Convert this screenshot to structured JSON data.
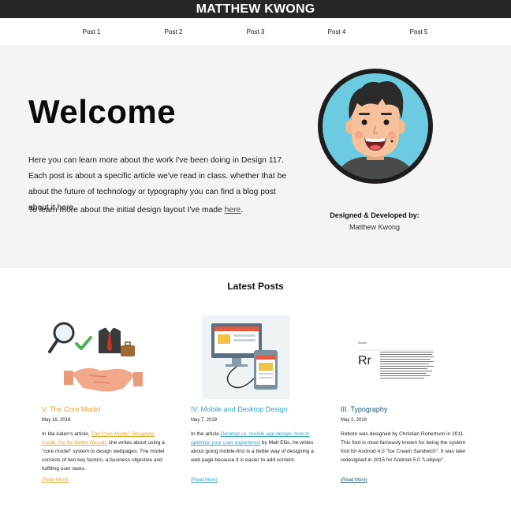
{
  "header": {
    "title": "MATTHEW KWONG"
  },
  "nav": {
    "items": [
      "Post 1",
      "Post 2",
      "Post 3",
      "Post 4",
      "Post 5"
    ]
  },
  "hero": {
    "heading": "Welcome",
    "paragraph1": "Here you can learn more about the work I've been doing in Design 117. Each post is about a specific article we've read in class. whether that be about the future of technology or typography you can find a blog post about it here.",
    "paragraph2_prefix": "To learn more about the initial design layout I've made ",
    "paragraph2_link": "here",
    "paragraph2_suffix": ".",
    "credit_title": "Designed & Developed by:",
    "credit_name": "Matthew Kwong"
  },
  "latest": {
    "heading": "Latest Posts",
    "posts": [
      {
        "title": "V. The Core Model",
        "date": "May 16, 2019",
        "text_before": "In Ida Aalen's article, ",
        "link": "The Core Model: Designing Inside Out for Better Results",
        "text_after": " she writes about using a \"core model\" system to design webpages. The model consists of two key factors, a business objective and fulfilling user tasks.",
        "read_more": "(Read More)",
        "color": "#e3a52b"
      },
      {
        "title": "IV. Mobile and Desktop Design",
        "date": "May 7, 2019",
        "text_before": "In the article ",
        "link": "Desktop vs. mobile app design: how to optimize your user experience",
        "text_after": " by Matt Ellis, he writes about going mobile-first is a better way of designing a web page because it is easier to add content.",
        "read_more": "(Read More)",
        "color": "#3aa0c8"
      },
      {
        "title": "III. Typography",
        "date": "May 2, 2019",
        "text_before": "Roboto was designed by Christian Robertson in 2011. This font is most famously known for being the system font for Android 4.0 \"Ice Cream Sandwich\". It was later redesigned in 2015 for Android 5.0 \"Lollipop\".",
        "link": "",
        "text_after": "",
        "read_more": "(Read More)",
        "color": "#1f5a73"
      }
    ],
    "typography_sample": {
      "name": "Roboto",
      "glyph": "Rr"
    }
  }
}
